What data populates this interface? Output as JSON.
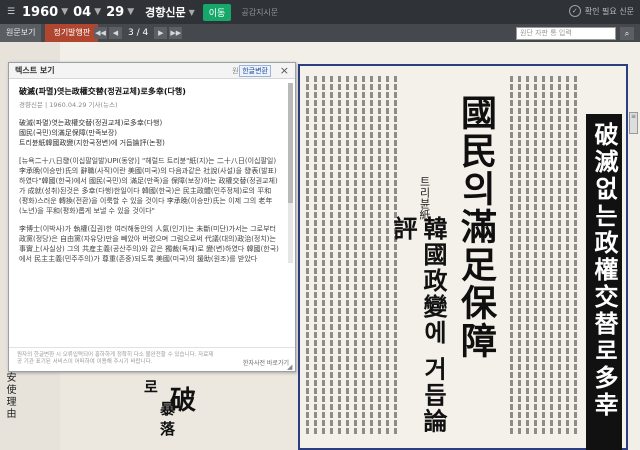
{
  "topbar": {
    "year": "1960",
    "month": "04",
    "day": "29",
    "paper": "경향신문",
    "go_label": "이동",
    "public_info": "공감지시문",
    "pin_label": "확인 필요 신문"
  },
  "subbar": {
    "tab_prev": "원문보기",
    "tab_active": "정기발행판",
    "page_current": "3",
    "page_sep": "/",
    "page_total": "4",
    "search_placeholder": "원단 자판 통 입력"
  },
  "popup": {
    "title": "텍스트 보기",
    "lang_original": "원문",
    "lang_korean": "한글변환",
    "article_title": "破滅(파멸)엿는政權交替(정권교체)로多幸(다행)",
    "article_meta": "경향신문 | 1960.04.29 기사(뉴스)",
    "lines": [
      "破滅(파멸)엿는政權交替(정권교체)로多幸(다행)",
      "國民(국민)의滿足保障(만족보장)",
      "트리뷴紙韓國政變(지한국정변)에 거듭論評(논평)"
    ],
    "para1": "[뉴욕二十八日發(이십팔일발)UPI(동양)] \"헤럴드 트리뷴\"紙(지)는 二十八日(이십팔일) 李承晩(이승만)氏의 辭職(사직)이란 美國(미국)의 다음과같은 社說(사설)을 發表(발표)하였다\"韓國(한국)에서 國民(국민)의 滿足(만족)을 保障(보장)하는 政權交替(정권교체)가 成就(성취)된것은 多幸(다행)한일이다 韓國(한국)은 民主政體(민주정체)로의 平和(평화)스러운 轉換(전환)을 이룩할 수 있을 것이다 李承晩(이승만)氏는 이제 그의 老年(노년)을 平和(평화)롭게 보낼 수 있을 것이다\"",
    "para2": "李博士(이박사)가 執權(집권)한 여러해동안의 人氣(인기)는 未斷(미단)가서는 그로부터 政黨(정당)은 自由黨(자유당)만을 빼았아 버렸으며 그럼으로써 代議(대의)政治(정치)는 事實上(사실상) 그의 共産主義(공산주의)와 같은 獨裁(독재)로 變(변)하였다 韓國(한국)에서 民主主義(민주주의)가 尊重(존중)되도록 美國(미국)의 援助(원조)를 받았다",
    "foot_note": "원자의 한글변환 시 오류입력되어 홍하하게 정확히 다소 불완전할 수 있습니다. 자료제공 기관 표기된 서비스이 어떠하여 이용해 주시기 바랍니다.",
    "dict_link": "한자사전 바로가기"
  },
  "page": {
    "headline": "國民의滿足保障",
    "sub_headline": "韓國政變에 거듭論評",
    "mini": "트리뷴紙",
    "black_block": "破滅없는政權交替로多幸",
    "bottom_chars": [
      "破",
      "로",
      "暴",
      "落"
    ],
    "left_col": [
      "安",
      "使",
      "理",
      "由"
    ]
  },
  "colors": {
    "topbar": "#2f3338",
    "accent_green": "#15a86a",
    "tab_red": "#b0462f",
    "page_border": "#2c3e80"
  }
}
